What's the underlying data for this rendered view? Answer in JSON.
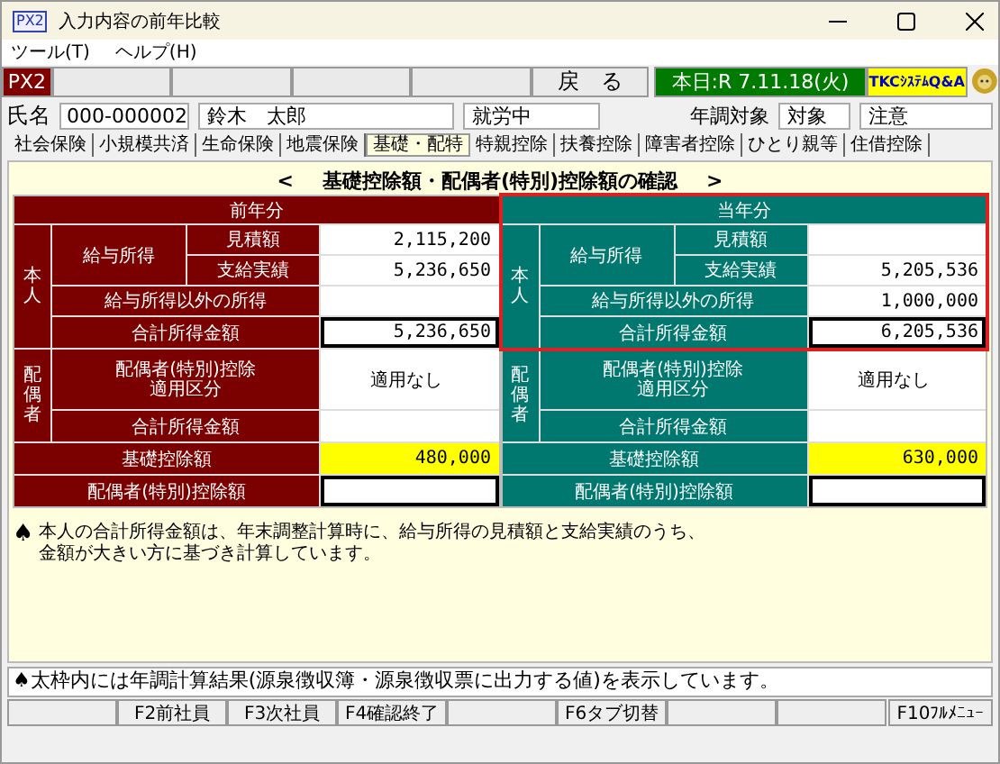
{
  "window": {
    "app_icon": "PX2",
    "title": "入力内容の前年比較"
  },
  "menu": [
    "ツール(T)",
    "ヘルプ(H)"
  ],
  "toolbar": [
    {
      "kind": "badge",
      "label": "PX2"
    },
    {
      "kind": "blank"
    },
    {
      "kind": "blank"
    },
    {
      "kind": "blank"
    },
    {
      "kind": "blank"
    },
    {
      "kind": "button",
      "label": "戻　る"
    },
    {
      "kind": "date",
      "label": "本日:R 7.11.18(火)"
    },
    {
      "kind": "qa",
      "label": "TKCｼｽﾃﾑQ&A"
    },
    {
      "kind": "mascot"
    }
  ],
  "person": {
    "label": "氏名",
    "code": "000-000002",
    "name": "鈴木　太郎",
    "status": "就労中",
    "adjust_label": "年調対象",
    "adjust": "対象",
    "note": "注意"
  },
  "tabs": [
    {
      "label": "社会保険",
      "selected": false
    },
    {
      "label": "小規模共済",
      "selected": false
    },
    {
      "label": "生命保険",
      "selected": false
    },
    {
      "label": "地震保険",
      "selected": false
    },
    {
      "label": "基礎・配特",
      "selected": true
    },
    {
      "label": "特親控除",
      "selected": false
    },
    {
      "label": "扶養控除",
      "selected": false
    },
    {
      "label": "障害者控除",
      "selected": false
    },
    {
      "label": "ひとり親等",
      "selected": false
    },
    {
      "label": "住借控除",
      "selected": false
    }
  ],
  "heading": {
    "prev": "<",
    "title": "基礎控除額・配偶者(特別)控除額の確認",
    "next": ">"
  },
  "panels": [
    {
      "title": "前年分",
      "color": "#7b0000",
      "highlighted": false,
      "self_label": "本人",
      "salary_label": "給与所得",
      "estimate_label": "見積額",
      "estimate": "2,115,200",
      "actual_label": "支給実績",
      "actual": "5,236,650",
      "other_label": "給与所得以外の所得",
      "total_label": "合計所得金額",
      "total": "5,236,650",
      "spouse_label": "配偶者",
      "spouse_class_label": [
        "配偶者(特別)控除",
        "適用区分"
      ],
      "spouse_class": "適用なし",
      "spouse_total_label": "合計所得金額",
      "basic_label": "基礎控除額",
      "basic": "480,000",
      "spouse_deduction_label": "配偶者(特別)控除額"
    },
    {
      "title": "当年分",
      "color": "#007870",
      "highlighted": true,
      "self_label": "本人",
      "salary_label": "給与所得",
      "estimate_label": "見積額",
      "actual_label": "支給実績",
      "actual": "5,205,536",
      "other_label": "給与所得以外の所得",
      "other": "1,000,000",
      "total_label": "合計所得金額",
      "total": "6,205,536",
      "spouse_label": "配偶者",
      "spouse_class_label": [
        "配偶者(特別)控除",
        "適用区分"
      ],
      "spouse_class": "適用なし",
      "spouse_total_label": "合計所得金額",
      "basic_label": "基礎控除額",
      "basic": "630,000",
      "spouse_deduction_label": "配偶者(特別)控除額"
    }
  ],
  "note": {
    "mark": "♠",
    "lines": [
      "本人の合計所得金額は、年末調整計算時に、給与所得の見積額と支給実績のうち、",
      "金額が大きい方に基づき計算しています。"
    ]
  },
  "status": {
    "mark": "♠",
    "text": "太枠内には年調計算結果(源泉徴収簿・源泉徴収票に出力する値)を表示しています。"
  },
  "function_keys": [
    {
      "kind": "blank"
    },
    {
      "kind": "key",
      "label": "F2前社員"
    },
    {
      "kind": "key",
      "label": "F3次社員"
    },
    {
      "kind": "key",
      "label": "F4確認終了"
    },
    {
      "kind": "blank"
    },
    {
      "kind": "key",
      "label": "F6タブ切替"
    },
    {
      "kind": "blank"
    },
    {
      "kind": "blank"
    },
    {
      "kind": "key",
      "label": "F10ﾌﾙﾒﾆｭｰ"
    }
  ]
}
